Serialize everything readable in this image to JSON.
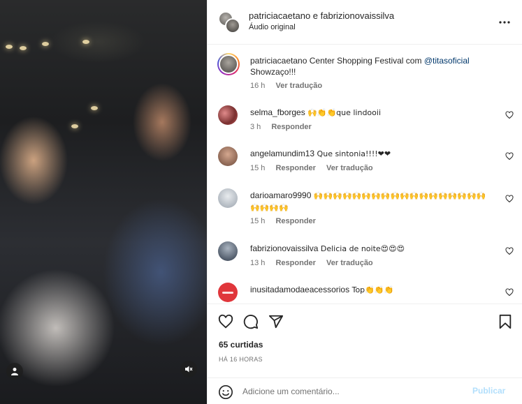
{
  "post": {
    "authors": "patriciacaetano e fabrizionovaissilva",
    "audio": "Áudio original",
    "caption": {
      "user": "patriciacaetano",
      "text_before": " Center Shopping Festival com ",
      "mention": "@titasoficial",
      "text_after": "Showzaço!!!",
      "time": "16 h",
      "translate": "Ver tradução"
    },
    "likes": "65 curtidas",
    "posted": "HÁ 16 HORAS"
  },
  "comments": [
    {
      "user": "selma_fborges",
      "text": "🙌👏👏que lindooii",
      "time": "3 h",
      "reply": "Responder",
      "translate": ""
    },
    {
      "user": "angelamundim13",
      "text": " Que sintonia!!!!❤❤",
      "time": "15 h",
      "reply": "Responder",
      "translate": "Ver tradução"
    },
    {
      "user": "darioamaro9990",
      "text": " 🙌🙌🙌🙌🙌🙌🙌🙌🙌🙌🙌🙌🙌🙌🙌🙌🙌🙌🙌🙌🙌🙌",
      "time": "15 h",
      "reply": "Responder",
      "translate": ""
    },
    {
      "user": "fabrizionovaissilva",
      "text": " Delicia de noite😍😍😍",
      "time": "13 h",
      "reply": "Responder",
      "translate": "Ver tradução"
    },
    {
      "user": "inusitadamodaeacessorios",
      "text": " Top👏👏👏",
      "time": "",
      "reply": "",
      "translate": ""
    }
  ],
  "composer": {
    "placeholder": "Adicione um comentário...",
    "publish": "Publicar"
  },
  "icons": {
    "more": "more-options-icon",
    "like": "heart-icon",
    "comment": "comment-icon",
    "share": "share-icon",
    "save": "bookmark-icon",
    "emoji": "smiley-icon",
    "mute": "muted-speaker-icon",
    "tagged": "person-icon"
  },
  "colors": {
    "link": "#00376b",
    "muted": "#737373",
    "publish_disabled": "#b2dffc",
    "heart_red": "#ed4956"
  }
}
